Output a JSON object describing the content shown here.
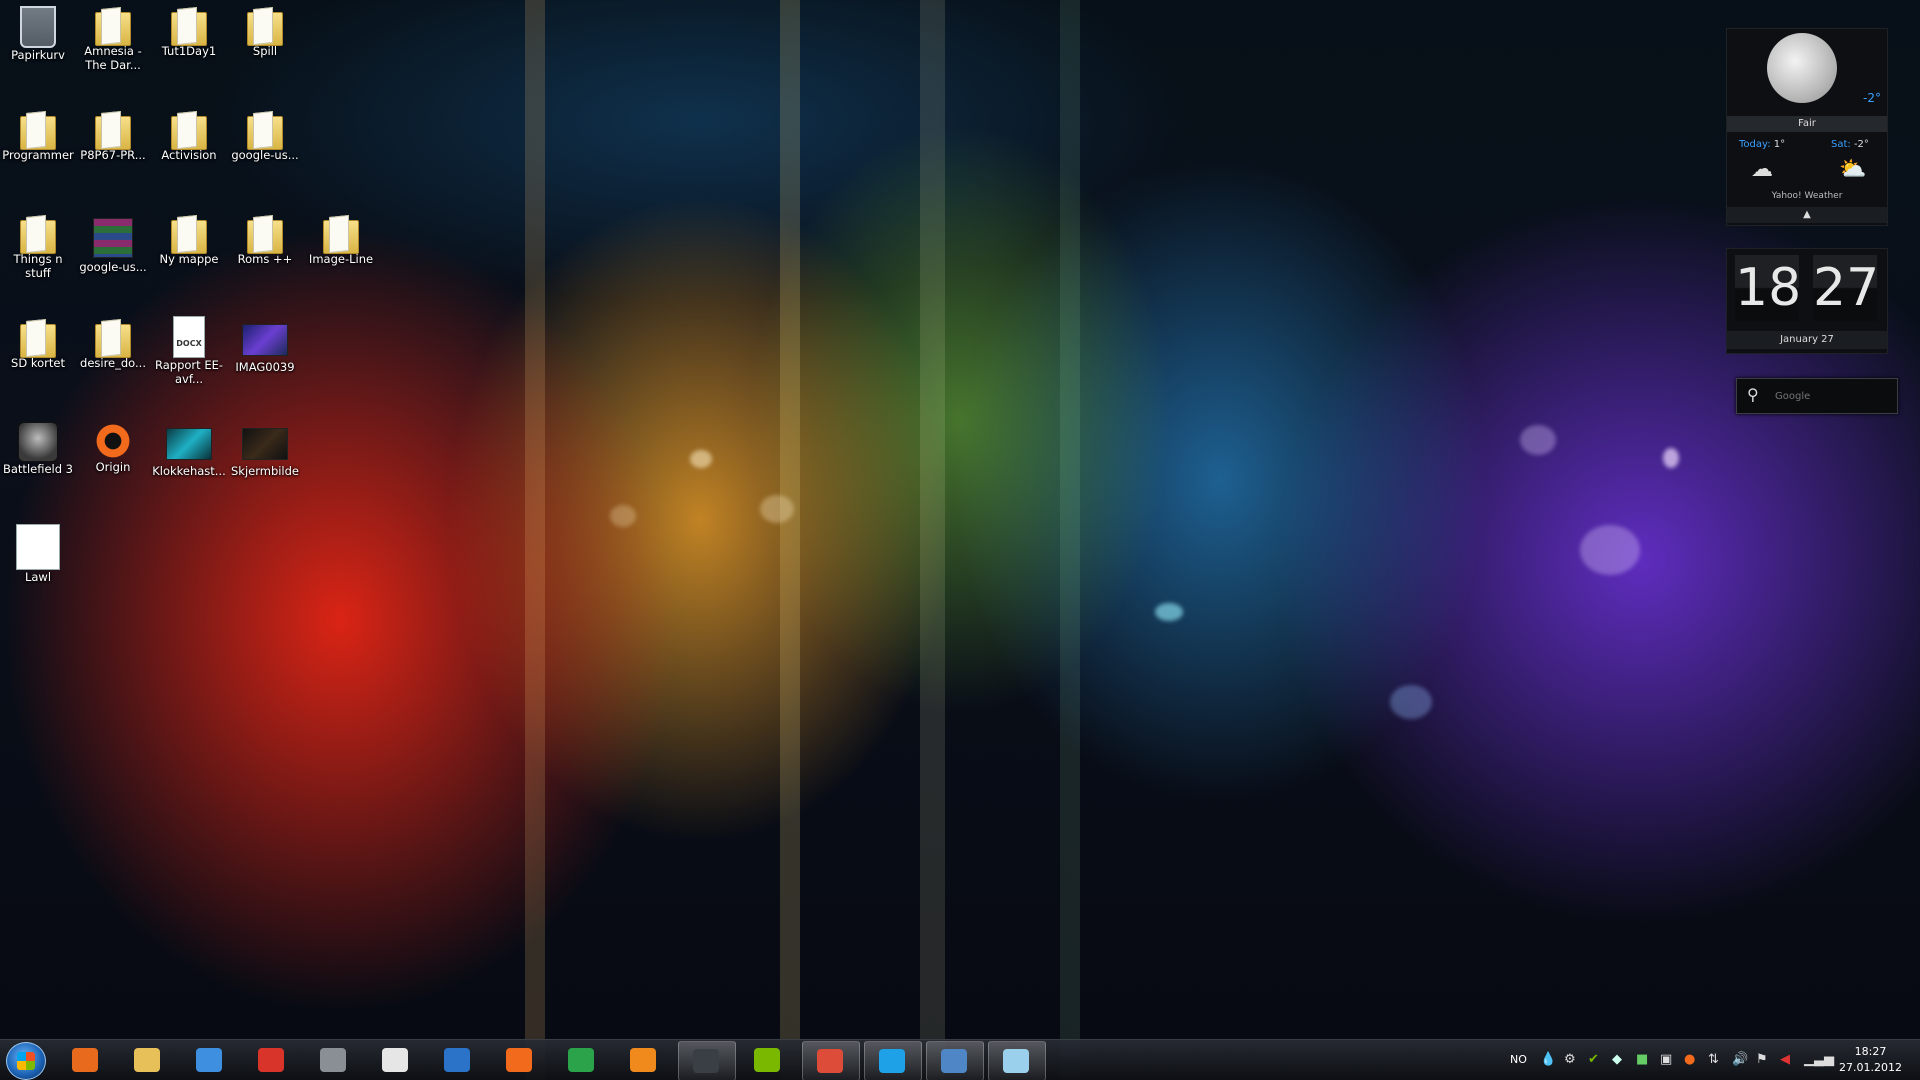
{
  "desktop": {
    "icons": [
      {
        "label": "Papirkurv",
        "icon": "recycle-bin-icon"
      },
      {
        "label": "Amnesia - The Dar...",
        "icon": "folder-icon"
      },
      {
        "label": "Tut1Day1",
        "icon": "folder-icon"
      },
      {
        "label": "Spill",
        "icon": "folder-icon"
      },
      {
        "label": "Programmer",
        "icon": "folder-icon"
      },
      {
        "label": "P8P67-PR...",
        "icon": "folder-icon"
      },
      {
        "label": "Activision",
        "icon": "folder-icon"
      },
      {
        "label": "google-us...",
        "icon": "folder-icon"
      },
      {
        "label": "Things n stuff",
        "icon": "folder-icon"
      },
      {
        "label": "google-us...",
        "icon": "winrar-archive-icon"
      },
      {
        "label": "Ny mappe",
        "icon": "folder-icon"
      },
      {
        "label": "Roms ++",
        "icon": "folder-icon"
      },
      {
        "label": "Image-Line",
        "icon": "folder-icon"
      },
      {
        "label": "SD kortet",
        "icon": "folder-icon"
      },
      {
        "label": "desire_do...",
        "icon": "folder-icon"
      },
      {
        "label": "Rapport EE-avf...",
        "icon": "docx-file-icon",
        "badge": "DOCX"
      },
      {
        "label": "IMAG0039",
        "icon": "image-file-icon"
      },
      {
        "label": "Battlefield 3",
        "icon": "battlefield-shortcut-icon"
      },
      {
        "label": "Origin",
        "icon": "origin-shortcut-icon"
      },
      {
        "label": "Klokkehast...",
        "icon": "image-file-icon"
      },
      {
        "label": "Skjermbilde",
        "icon": "image-file-icon"
      },
      {
        "label": "Lawl",
        "icon": "text-file-icon"
      }
    ]
  },
  "weather": {
    "current_temp": "-2°",
    "condition": "Fair",
    "today_label": "Today:",
    "today_temp": "1°",
    "sat_label": "Sat:",
    "sat_temp": "-2°",
    "provider": "Yahoo! Weather",
    "collapse_glyph": "▲"
  },
  "clock": {
    "hour": "18",
    "minute": "27",
    "date": "January 27"
  },
  "google_search": {
    "placeholder": "Google"
  },
  "taskbar": {
    "pinned": [
      {
        "name": "windows-media-player",
        "color": "#e86a1c"
      },
      {
        "name": "explorer",
        "color": "#e8c05a"
      },
      {
        "name": "itunes",
        "color": "#3f8fe0"
      },
      {
        "name": "ccleaner",
        "color": "#d8342a"
      },
      {
        "name": "sc-tool",
        "color": "#8a8f96"
      },
      {
        "name": "notepad-doc",
        "color": "#e6e6e6"
      },
      {
        "name": "city-app",
        "color": "#2a73c8"
      },
      {
        "name": "origin",
        "color": "#f26a1b"
      },
      {
        "name": "cpuid",
        "color": "#2aa34a"
      },
      {
        "name": "firefox",
        "color": "#f08a1c"
      },
      {
        "name": "steam",
        "color": "#3a3f45"
      },
      {
        "name": "spotify",
        "color": "#7ab800"
      },
      {
        "name": "chrome",
        "color": "#dd4b39"
      },
      {
        "name": "skype",
        "color": "#1ea1e6"
      },
      {
        "name": "control-panel",
        "color": "#4f86c6"
      },
      {
        "name": "paint",
        "color": "#9ad0ec"
      }
    ],
    "language": "NO",
    "time": "18:27",
    "date": "27.01.2012"
  }
}
